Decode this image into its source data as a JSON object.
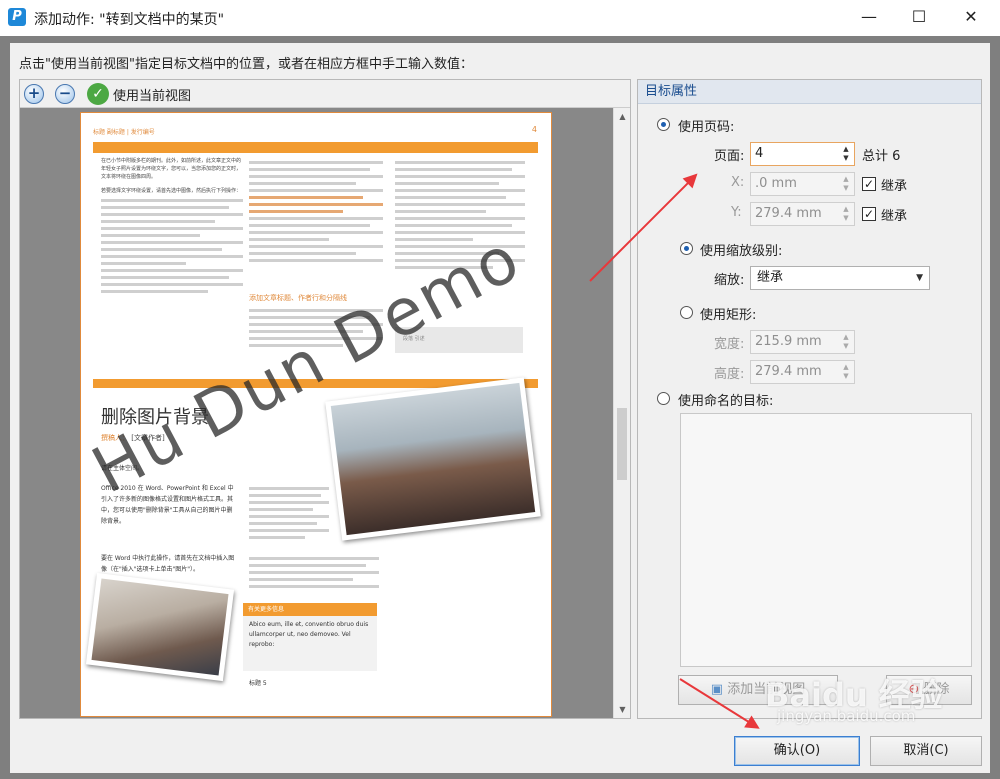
{
  "window": {
    "title": "添加动作: \"转到文档中的某页\"",
    "app_icon": "P",
    "minimize_glyph": "—",
    "maximize_glyph": "☐",
    "close_glyph": "✕"
  },
  "instruction": "点击\"使用当前视图\"指定目标文档中的位置，或者在相应方框中手工输入数值：",
  "toolbar": {
    "zoom_in_glyph": "+",
    "zoom_out_glyph": "−",
    "use_current_view_label": "使用当前视图",
    "check_glyph": "✓"
  },
  "document_page": {
    "header": "标题 副标题 | 发行编号",
    "page_number": "4",
    "col1": "在已小节中附版多栏的期刊。此外，如前所述，此文章正文中的年轻女子照片设置为环绕文字，您可以，当您添加您的正文时，文本将环绕在图像四周。",
    "col1b": "若要选择文字环绕设置，请首先选中图像，然后执行下列操作：",
    "col2_subhead": "添加文章标题、作者行和分隔线",
    "title": "删除图片背景",
    "author_label": "撰稿人：",
    "author_value": "[文章作者]",
    "body1": "请在主体空间。",
    "body2": "Office 2010 在 Word、PowerPoint 和 Excel 中引入了许多新的图像格式设置和图片格式工具。其中，您可以使用\"删除背景\"工具从自己的图片中删除背景。",
    "body3": "要在 Word 中执行此操作，请首先在文档中插入图像（在\"插入\"选项卡上单击\"图片\"）。",
    "sidebar_head": "有关更多信息",
    "sidebar_body": "Abico eum, ille et, conventio obruo duis ullamcorper ut, neo demoveo. Vel reprobo:",
    "sidebar_footer": "标题 5",
    "grey_box_text": "段落 引述",
    "watermark": "Hu Dun Demo"
  },
  "target_properties": {
    "header": "目标属性",
    "use_page_number": {
      "label": "使用页码:",
      "selected": true,
      "page_label": "页面:",
      "page_value": "4",
      "total_label": "总计 6",
      "x_label": "X:",
      "x_value": ".0 mm",
      "x_inherit_label": "继承",
      "x_inherit_checked": true,
      "y_label": "Y:",
      "y_value": "279.4 mm",
      "y_inherit_label": "继承",
      "y_inherit_checked": true
    },
    "use_zoom_level": {
      "label": "使用缩放级别:",
      "selected": true,
      "zoom_label": "缩放:",
      "zoom_value": "继承"
    },
    "use_rectangle": {
      "label": "使用矩形:",
      "selected": false,
      "width_label": "宽度:",
      "width_value": "215.9 mm",
      "height_label": "高度:",
      "height_value": "279.4 mm"
    },
    "use_named_destination": {
      "label": "使用命名的目标:",
      "selected": false
    },
    "add_current_view_button": "添加当前视图",
    "delete_button": "删除"
  },
  "footer": {
    "ok_button": "确认(O)",
    "cancel_button": "取消(C)"
  },
  "overlay_watermark": {
    "brand": "Baidu 经验",
    "url": "jingyan.baidu.com"
  },
  "colors": {
    "accent_orange": "#f29b30",
    "annotation_red": "#e8383b",
    "header_blue": "#1a4d8f"
  }
}
